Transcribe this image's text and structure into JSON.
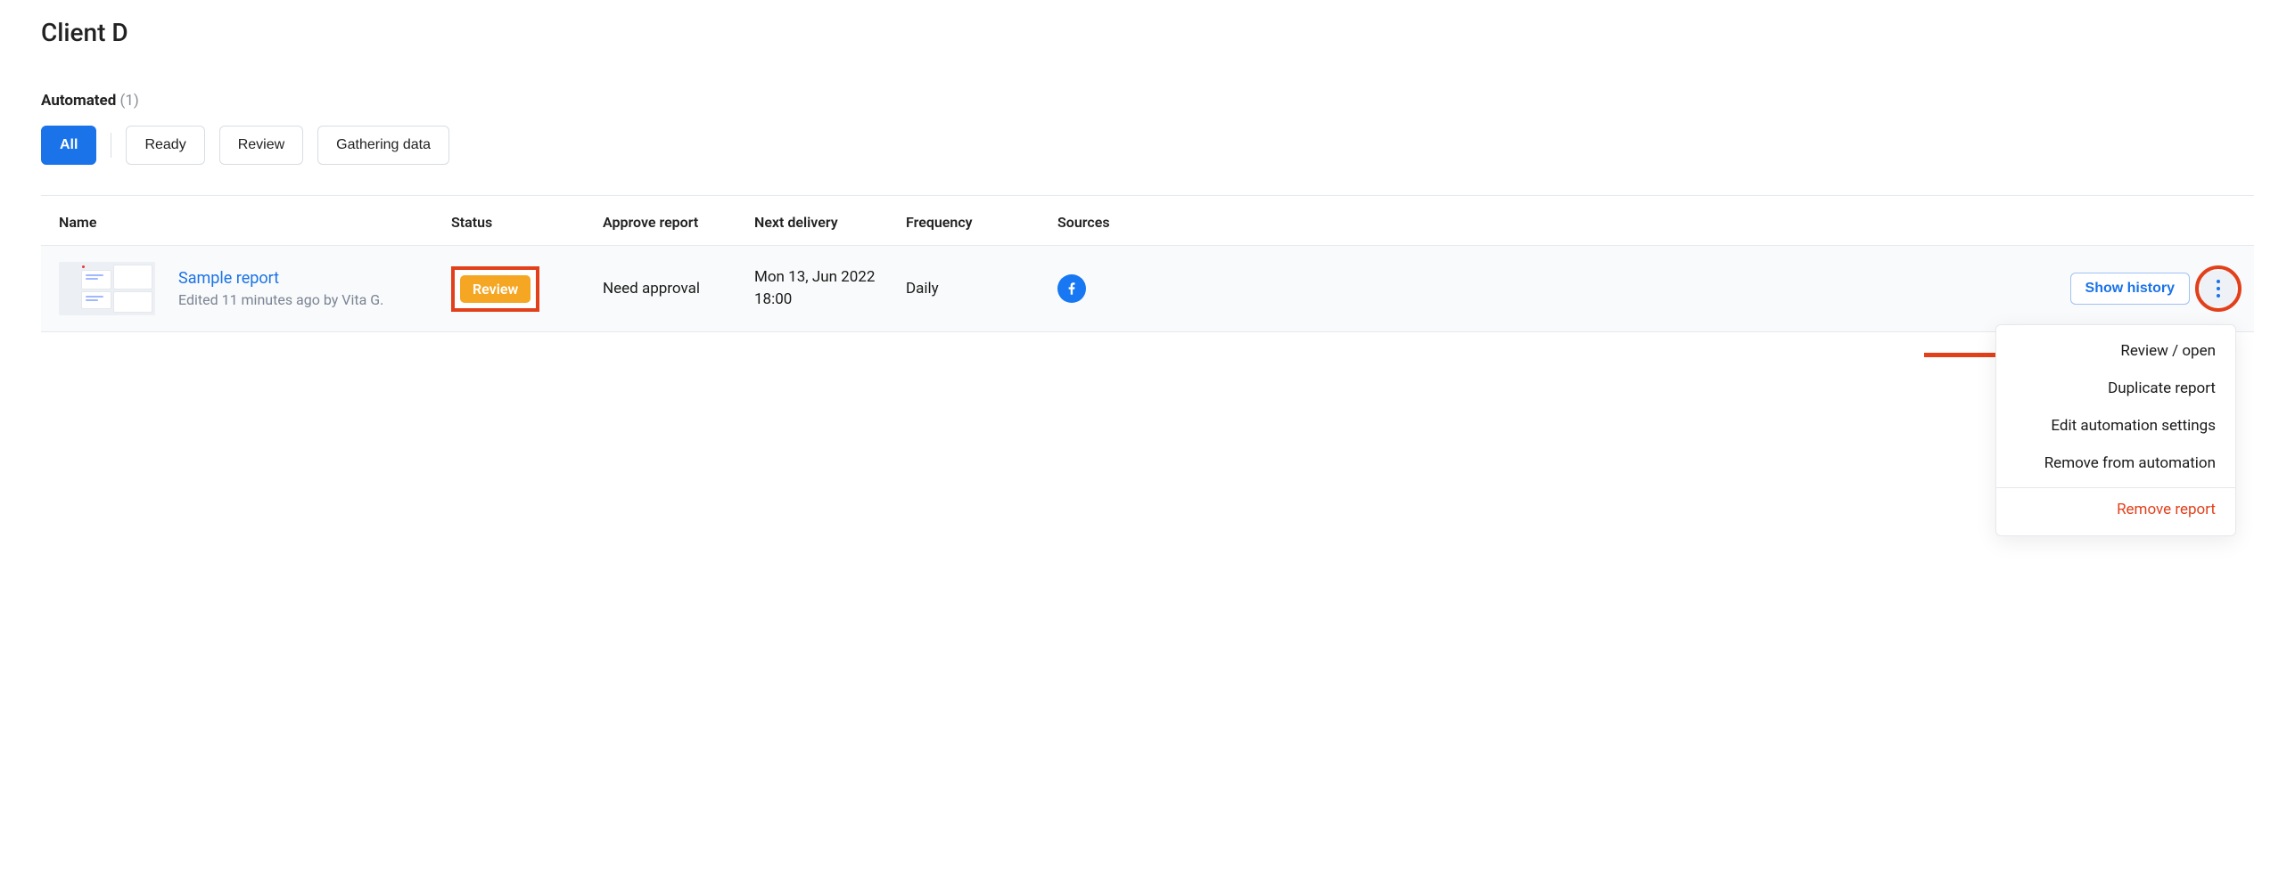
{
  "page": {
    "title": "Client D"
  },
  "section": {
    "label": "Automated",
    "count": "(1)"
  },
  "filters": {
    "all": "All",
    "ready": "Ready",
    "review": "Review",
    "gathering": "Gathering data"
  },
  "table": {
    "headers": {
      "name": "Name",
      "status": "Status",
      "approve": "Approve report",
      "next_delivery": "Next delivery",
      "frequency": "Frequency",
      "sources": "Sources"
    },
    "rows": [
      {
        "name": "Sample report",
        "edited": "Edited 11 minutes ago by Vita G.",
        "status_label": "Review",
        "approve": "Need approval",
        "next_delivery_date": "Mon 13, Jun 2022",
        "next_delivery_time": "18:00",
        "frequency": "Daily",
        "source_icon": "facebook"
      }
    ],
    "actions": {
      "show_history": "Show history"
    }
  },
  "menu": {
    "review_open": "Review / open",
    "duplicate": "Duplicate report",
    "edit_settings": "Edit automation settings",
    "remove_automation": "Remove from automation",
    "remove_report": "Remove report"
  }
}
